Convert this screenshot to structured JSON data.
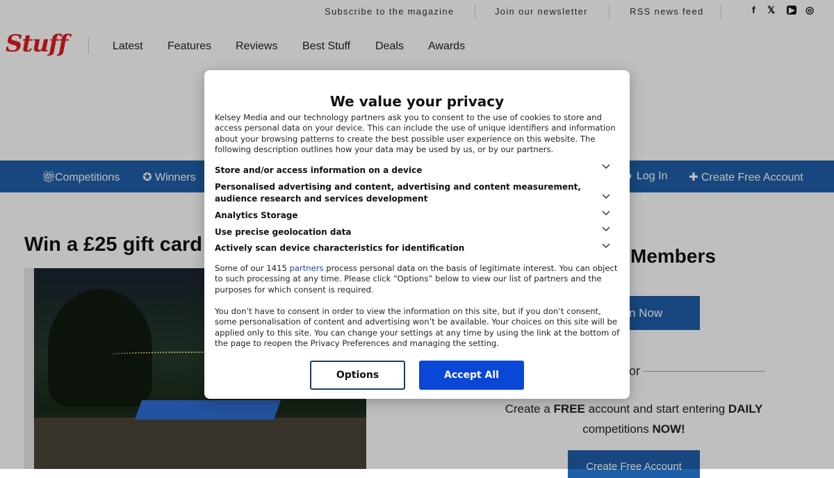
{
  "topbar": {
    "links": [
      "Subscribe to the magazine",
      "Join our newsletter",
      "RSS news feed"
    ],
    "social": {
      "facebook": "f",
      "x": "𝕏",
      "youtube": "▶",
      "instagram": "◎"
    }
  },
  "header": {
    "logo": "Stuff",
    "nav": [
      "Latest",
      "Features",
      "Reviews",
      "Best Stuff",
      "Deals",
      "Awards"
    ]
  },
  "subnav": {
    "left": [
      "Competitions",
      "Winners"
    ],
    "right": [
      "Log In",
      "Create Free Account"
    ]
  },
  "main": {
    "headline": "Win a £25 gift card f",
    "members_title": "Members",
    "join_button": "n Now",
    "or": "or",
    "cta": {
      "prefix": "Create a ",
      "free": "FREE",
      "middle": " account and start entering ",
      "daily": "DAILY",
      "line2": "competitions ",
      "now": "NOW!"
    },
    "create_button": "Create Free Account"
  },
  "consent": {
    "title": "We value your privacy",
    "intro": "Kelsey Media and our technology partners ask you to consent to the use of cookies to store and access personal data on your device. This can include the use of unique identifiers and information about your browsing patterns to create the best possible user experience on this website. The following description outlines how your data may be used by us, or by our partners.",
    "purposes": [
      "Store and/or access information on a device",
      "Personalised advertising and content, advertising and content measurement, audience research and services development",
      "Analytics Storage",
      "Use precise geolocation data",
      "Actively scan device characteristics for identification"
    ],
    "legit": {
      "before": "Some of our 1415 ",
      "link": "partners",
      "after": " process personal data on the basis of legitimate interest. You can object to such processing at any time. Please click “Options” below to view our list of partners and the purposes for which consent is required."
    },
    "note": "You don’t have to consent in order to view the information on this site, but if you don’t consent, some personalisation of content and advertising won’t be available. Your choices on this site will be applied only to this site. You can change your settings at any time by using the link at the bottom of the page to reopen the Privacy Preferences and managing the setting.",
    "options_label": "Options",
    "accept_label": "Accept All"
  },
  "colors": {
    "brand_red": "#e01b22",
    "nav_blue": "#1f5fa8",
    "accept_blue": "#0b47d6"
  }
}
